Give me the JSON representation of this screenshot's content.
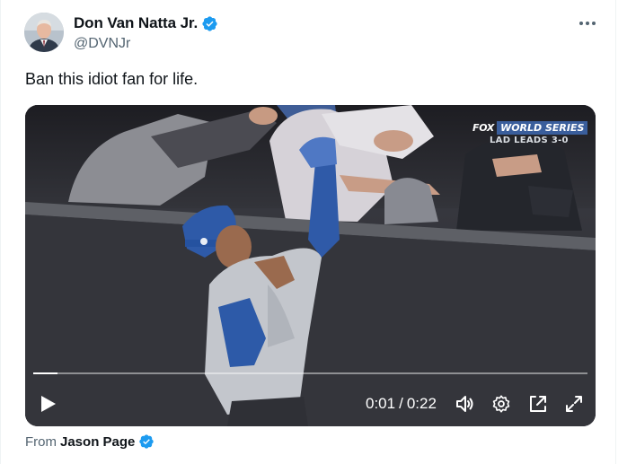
{
  "author": {
    "display_name": "Don Van Natta Jr.",
    "handle": "@DVNJr",
    "verified_icon": "verified-badge-icon"
  },
  "tweet": {
    "text": "Ban this idiot fan for life."
  },
  "video": {
    "network": "FOX",
    "series_label": "WORLD SERIES",
    "score_line": "LAD LEADS 3-0",
    "current_time": "0:01",
    "separator": "/",
    "duration": "0:22",
    "progress_fraction": 0.043,
    "icons": [
      "play-icon",
      "volume-icon",
      "settings-icon",
      "pop-out-icon",
      "fullscreen-icon"
    ]
  },
  "attribution": {
    "prefix": "From",
    "source_name": "Jason Page"
  },
  "colors": {
    "verified_blue": "#1d9bf0",
    "secondary_text": "#536471",
    "ws_badge": "#3a5e9c"
  }
}
